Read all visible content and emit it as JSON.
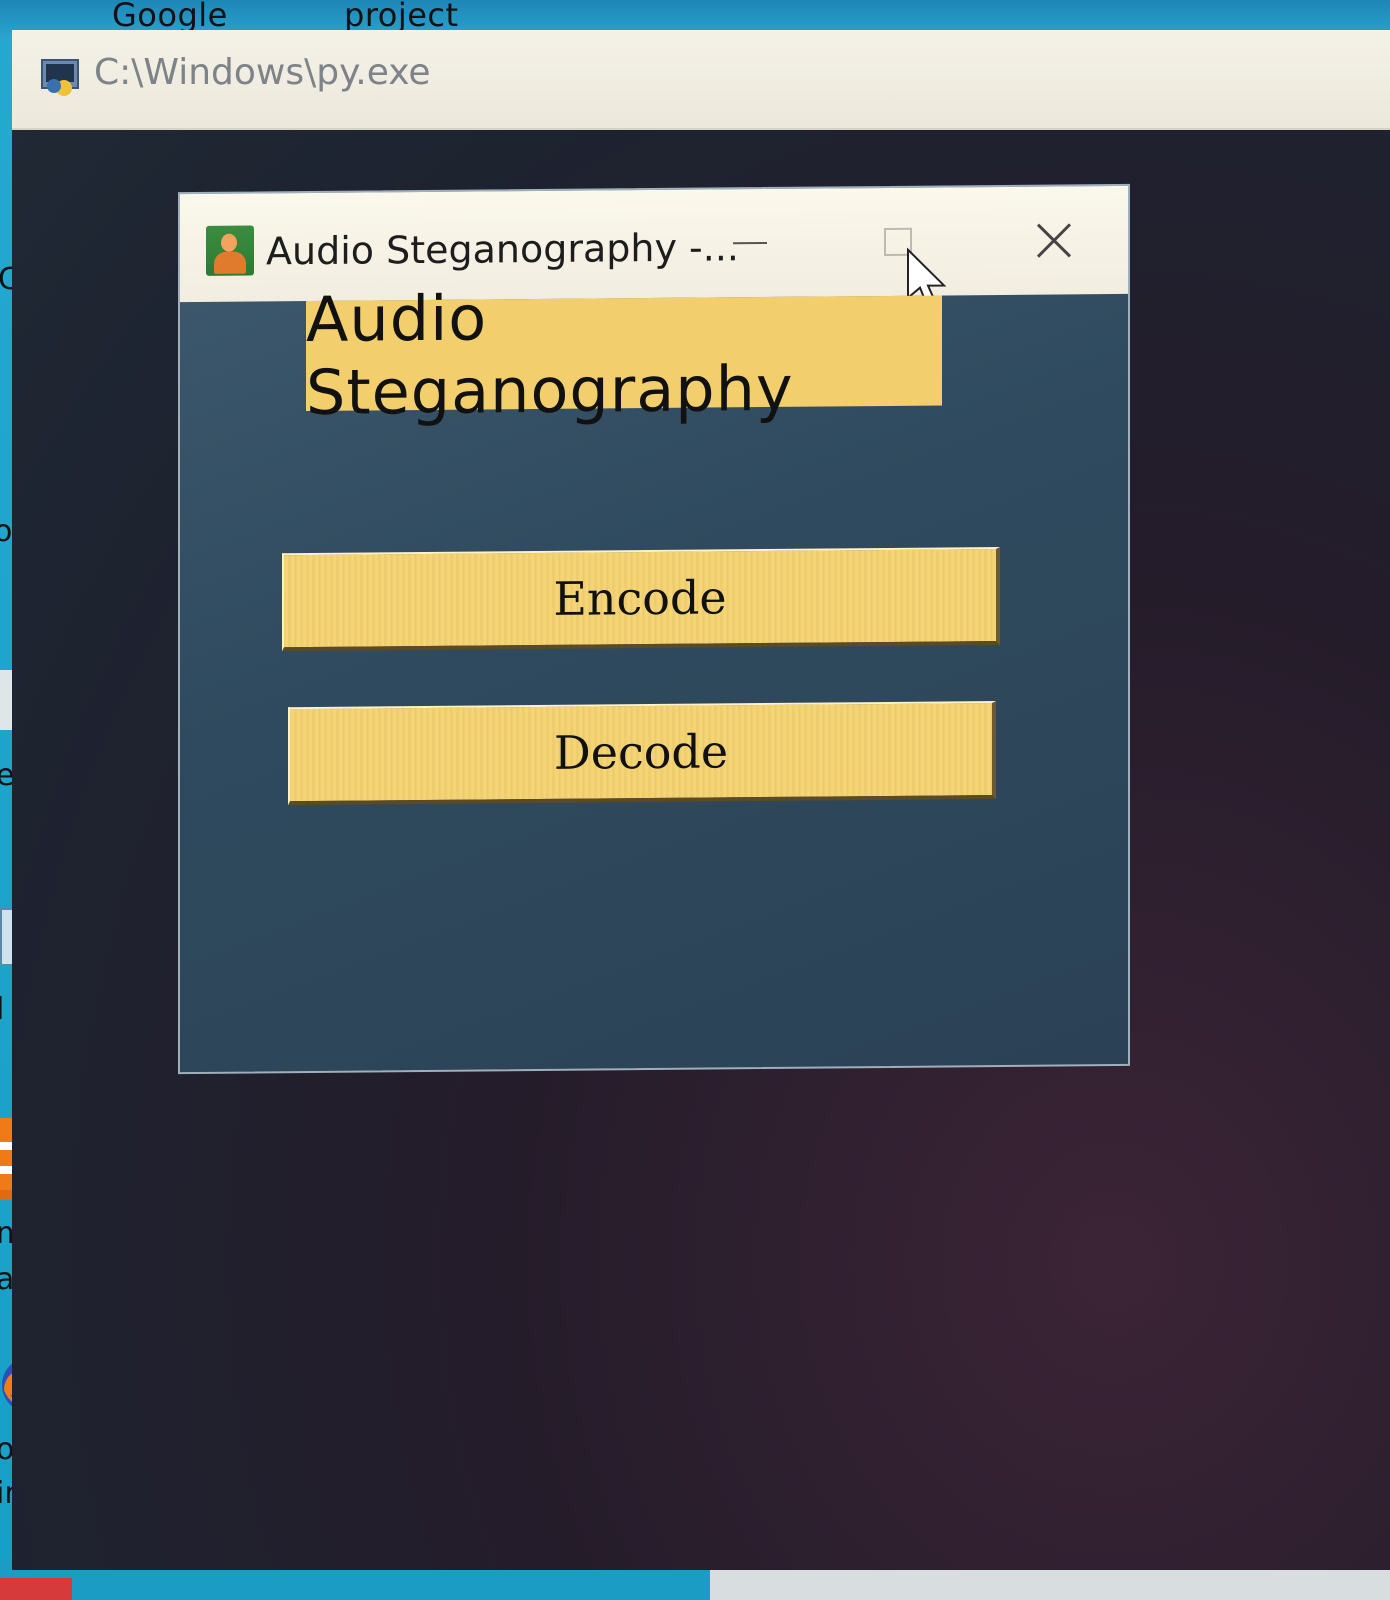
{
  "desktop": {
    "top_labels": [
      "Google",
      "project"
    ],
    "left_labels": [
      "C",
      "ork",
      "e B",
      "l Pa",
      "medi",
      "ayer",
      "ozilla",
      "irefox"
    ]
  },
  "console": {
    "title": "C:\\Windows\\py.exe"
  },
  "app": {
    "window_title": "Audio Steganography -...",
    "heading": "Audio Steganography",
    "encode_label": "Encode",
    "decode_label": "Decode"
  },
  "icons": {
    "console_icon": "python-console-icon",
    "app_icon": "user-app-icon",
    "minimize": "minimize-icon",
    "maximize": "maximize-icon",
    "close": "close-icon",
    "cursor": "mouse-pointer-icon"
  },
  "colors": {
    "button_bg": "#f2cf6c",
    "app_bg": "#34505f",
    "desktop_bg": "#1fa3c8"
  }
}
